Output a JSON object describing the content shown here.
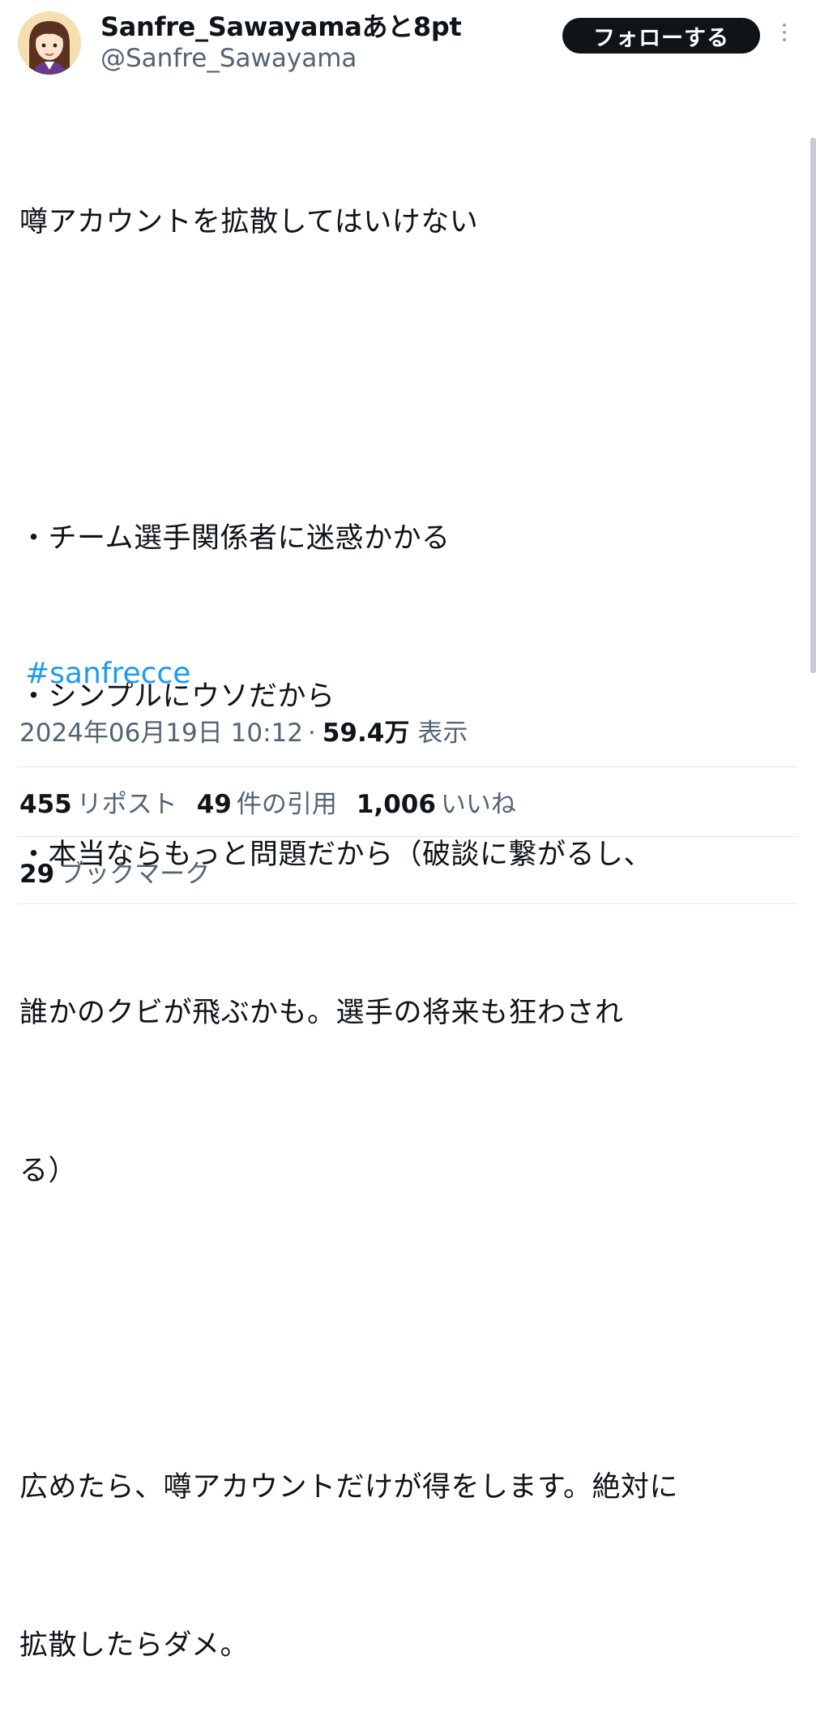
{
  "author": {
    "display_name": "Sanfre_Sawayamaあと8pt",
    "handle": "@Sanfre_Sawayama",
    "avatar": "illustrated-girl-avatar"
  },
  "follow_button": {
    "label": "フォローする"
  },
  "more_menu": {
    "icon": "more-vertical-icon"
  },
  "tweet": {
    "lines": [
      "噂アカウントを拡散してはいけない",
      "",
      "・チーム選手関係者に迷惑かかる",
      "・シンプルにウソだから",
      "・本当ならもっと問題だから（破談に繋がるし、",
      "誰かのクビが飛ぶかも。選手の将来も狂わされ",
      "る）",
      "",
      "広めたら、噂アカウントだけが得をします。絶対に",
      "拡散したらダメ。"
    ],
    "hashtag": "#sanfrecce"
  },
  "meta": {
    "timestamp": "2024年06月19日 10:12",
    "separator": "·",
    "views_count": "59.4万",
    "views_label": "表示"
  },
  "stats": {
    "reposts": {
      "count": "455",
      "label": "リポスト"
    },
    "quotes": {
      "count": "49",
      "label": "件の引用"
    },
    "likes": {
      "count": "1,006",
      "label": "いいね"
    },
    "bookmarks": {
      "count": "29",
      "label": "ブックマーク"
    }
  },
  "colors": {
    "text": "#0f1419",
    "secondary": "#536471",
    "link": "#1d9bf0",
    "button_bg": "#0f1419",
    "divider": "#e1e6ea"
  }
}
